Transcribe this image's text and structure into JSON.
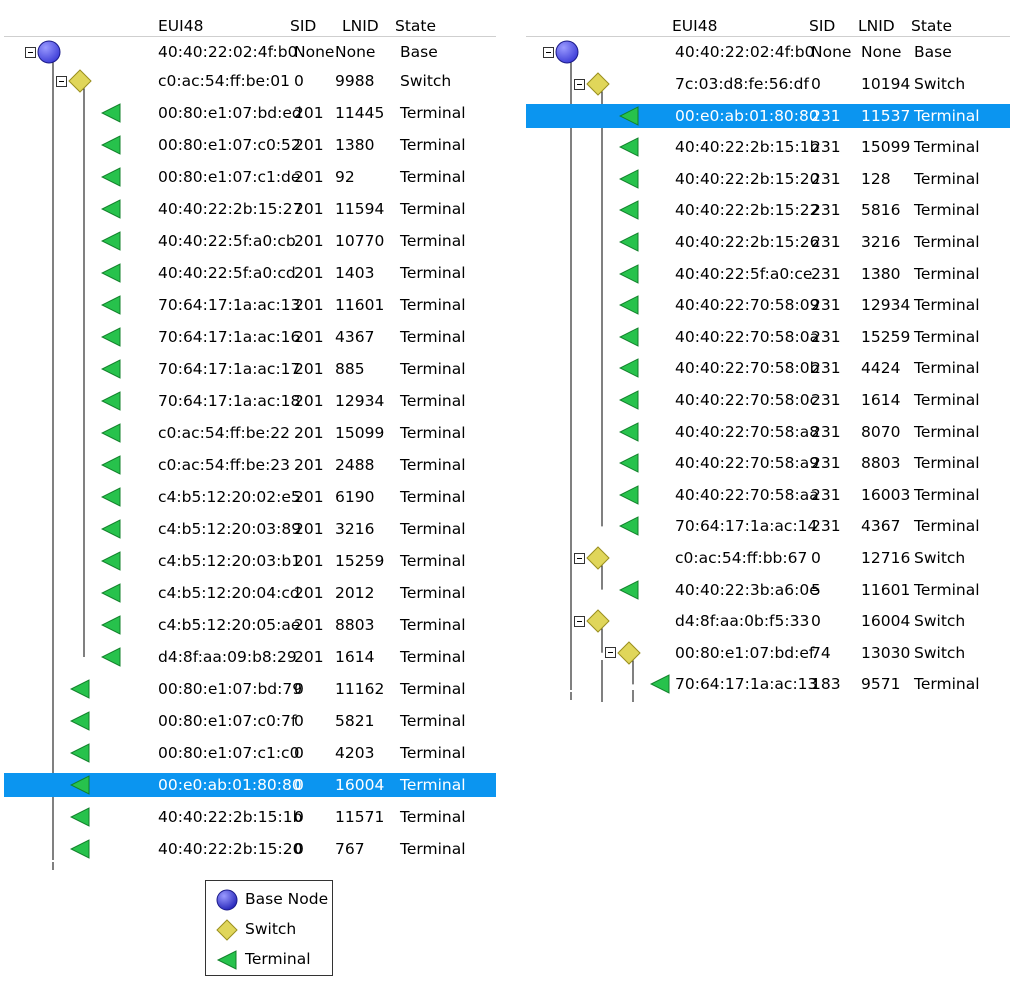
{
  "columns": [
    "EUI48",
    "SID",
    "LNID",
    "State"
  ],
  "colors": {
    "selection": "#0b95f0",
    "base_node": "#3b3bd6",
    "switch": "#e0d65a",
    "terminal": "#27c24c"
  },
  "left_panel": {
    "rows": [
      {
        "eui48": "40:40:22:02:4f:b0",
        "sid": "None",
        "lnid": "None",
        "state": "Base",
        "type": "base",
        "level": 0,
        "expander": true
      },
      {
        "eui48": "c0:ac:54:ff:be:01",
        "sid": "0",
        "lnid": "9988",
        "state": "Switch",
        "type": "switch",
        "level": 1,
        "expander": true
      },
      {
        "eui48": "00:80:e1:07:bd:ed",
        "sid": "201",
        "lnid": "11445",
        "state": "Terminal",
        "type": "terminal",
        "level": 2
      },
      {
        "eui48": "00:80:e1:07:c0:52",
        "sid": "201",
        "lnid": "1380",
        "state": "Terminal",
        "type": "terminal",
        "level": 2
      },
      {
        "eui48": "00:80:e1:07:c1:de",
        "sid": "201",
        "lnid": "92",
        "state": "Terminal",
        "type": "terminal",
        "level": 2
      },
      {
        "eui48": "40:40:22:2b:15:27",
        "sid": "201",
        "lnid": "11594",
        "state": "Terminal",
        "type": "terminal",
        "level": 2
      },
      {
        "eui48": "40:40:22:5f:a0:cb",
        "sid": "201",
        "lnid": "10770",
        "state": "Terminal",
        "type": "terminal",
        "level": 2
      },
      {
        "eui48": "40:40:22:5f:a0:cd",
        "sid": "201",
        "lnid": "1403",
        "state": "Terminal",
        "type": "terminal",
        "level": 2
      },
      {
        "eui48": "70:64:17:1a:ac:13",
        "sid": "201",
        "lnid": "11601",
        "state": "Terminal",
        "type": "terminal",
        "level": 2
      },
      {
        "eui48": "70:64:17:1a:ac:16",
        "sid": "201",
        "lnid": "4367",
        "state": "Terminal",
        "type": "terminal",
        "level": 2
      },
      {
        "eui48": "70:64:17:1a:ac:17",
        "sid": "201",
        "lnid": "885",
        "state": "Terminal",
        "type": "terminal",
        "level": 2
      },
      {
        "eui48": "70:64:17:1a:ac:18",
        "sid": "201",
        "lnid": "12934",
        "state": "Terminal",
        "type": "terminal",
        "level": 2
      },
      {
        "eui48": "c0:ac:54:ff:be:22",
        "sid": "201",
        "lnid": "15099",
        "state": "Terminal",
        "type": "terminal",
        "level": 2
      },
      {
        "eui48": "c0:ac:54:ff:be:23",
        "sid": "201",
        "lnid": "2488",
        "state": "Terminal",
        "type": "terminal",
        "level": 2
      },
      {
        "eui48": "c4:b5:12:20:02:e5",
        "sid": "201",
        "lnid": "6190",
        "state": "Terminal",
        "type": "terminal",
        "level": 2
      },
      {
        "eui48": "c4:b5:12:20:03:89",
        "sid": "201",
        "lnid": "3216",
        "state": "Terminal",
        "type": "terminal",
        "level": 2
      },
      {
        "eui48": "c4:b5:12:20:03:b1",
        "sid": "201",
        "lnid": "15259",
        "state": "Terminal",
        "type": "terminal",
        "level": 2
      },
      {
        "eui48": "c4:b5:12:20:04:cd",
        "sid": "201",
        "lnid": "2012",
        "state": "Terminal",
        "type": "terminal",
        "level": 2
      },
      {
        "eui48": "c4:b5:12:20:05:ae",
        "sid": "201",
        "lnid": "8803",
        "state": "Terminal",
        "type": "terminal",
        "level": 2
      },
      {
        "eui48": "d4:8f:aa:09:b8:29",
        "sid": "201",
        "lnid": "1614",
        "state": "Terminal",
        "type": "terminal",
        "level": 2
      },
      {
        "eui48": "00:80:e1:07:bd:79",
        "sid": "0",
        "lnid": "11162",
        "state": "Terminal",
        "type": "terminal",
        "level": 1
      },
      {
        "eui48": "00:80:e1:07:c0:7f",
        "sid": "0",
        "lnid": "5821",
        "state": "Terminal",
        "type": "terminal",
        "level": 1
      },
      {
        "eui48": "00:80:e1:07:c1:c0",
        "sid": "0",
        "lnid": "4203",
        "state": "Terminal",
        "type": "terminal",
        "level": 1
      },
      {
        "eui48": "00:e0:ab:01:80:80",
        "sid": "0",
        "lnid": "16004",
        "state": "Terminal",
        "type": "terminal",
        "level": 1,
        "selected": true
      },
      {
        "eui48": "40:40:22:2b:15:1b",
        "sid": "0",
        "lnid": "11571",
        "state": "Terminal",
        "type": "terminal",
        "level": 1
      },
      {
        "eui48": "40:40:22:2b:15:20",
        "sid": "0",
        "lnid": "767",
        "state": "Terminal",
        "type": "terminal",
        "level": 1
      }
    ]
  },
  "right_panel": {
    "rows": [
      {
        "eui48": "40:40:22:02:4f:b0",
        "sid": "None",
        "lnid": "None",
        "state": "Base",
        "type": "base",
        "level": 0,
        "expander": true
      },
      {
        "eui48": "7c:03:d8:fe:56:df",
        "sid": "0",
        "lnid": "10194",
        "state": "Switch",
        "type": "switch",
        "level": 1,
        "expander": true
      },
      {
        "eui48": "00:e0:ab:01:80:80",
        "sid": "231",
        "lnid": "11537",
        "state": "Terminal",
        "type": "terminal",
        "level": 2,
        "selected": true
      },
      {
        "eui48": "40:40:22:2b:15:1b",
        "sid": "231",
        "lnid": "15099",
        "state": "Terminal",
        "type": "terminal",
        "level": 2
      },
      {
        "eui48": "40:40:22:2b:15:20",
        "sid": "231",
        "lnid": "128",
        "state": "Terminal",
        "type": "terminal",
        "level": 2
      },
      {
        "eui48": "40:40:22:2b:15:22",
        "sid": "231",
        "lnid": "5816",
        "state": "Terminal",
        "type": "terminal",
        "level": 2
      },
      {
        "eui48": "40:40:22:2b:15:26",
        "sid": "231",
        "lnid": "3216",
        "state": "Terminal",
        "type": "terminal",
        "level": 2
      },
      {
        "eui48": "40:40:22:5f:a0:ce",
        "sid": "231",
        "lnid": "1380",
        "state": "Terminal",
        "type": "terminal",
        "level": 2
      },
      {
        "eui48": "40:40:22:70:58:09",
        "sid": "231",
        "lnid": "12934",
        "state": "Terminal",
        "type": "terminal",
        "level": 2
      },
      {
        "eui48": "40:40:22:70:58:0a",
        "sid": "231",
        "lnid": "15259",
        "state": "Terminal",
        "type": "terminal",
        "level": 2
      },
      {
        "eui48": "40:40:22:70:58:0b",
        "sid": "231",
        "lnid": "4424",
        "state": "Terminal",
        "type": "terminal",
        "level": 2
      },
      {
        "eui48": "40:40:22:70:58:0c",
        "sid": "231",
        "lnid": "1614",
        "state": "Terminal",
        "type": "terminal",
        "level": 2
      },
      {
        "eui48": "40:40:22:70:58:a8",
        "sid": "231",
        "lnid": "8070",
        "state": "Terminal",
        "type": "terminal",
        "level": 2
      },
      {
        "eui48": "40:40:22:70:58:a9",
        "sid": "231",
        "lnid": "8803",
        "state": "Terminal",
        "type": "terminal",
        "level": 2
      },
      {
        "eui48": "40:40:22:70:58:aa",
        "sid": "231",
        "lnid": "16003",
        "state": "Terminal",
        "type": "terminal",
        "level": 2
      },
      {
        "eui48": "70:64:17:1a:ac:14",
        "sid": "231",
        "lnid": "4367",
        "state": "Terminal",
        "type": "terminal",
        "level": 2
      },
      {
        "eui48": "c0:ac:54:ff:bb:67",
        "sid": "0",
        "lnid": "12716",
        "state": "Switch",
        "type": "switch",
        "level": 1,
        "expander": true
      },
      {
        "eui48": "40:40:22:3b:a6:0e",
        "sid": "5",
        "lnid": "11601",
        "state": "Terminal",
        "type": "terminal",
        "level": 2
      },
      {
        "eui48": "d4:8f:aa:0b:f5:33",
        "sid": "0",
        "lnid": "16004",
        "state": "Switch",
        "type": "switch",
        "level": 1,
        "expander": true
      },
      {
        "eui48": "00:80:e1:07:bd:ef",
        "sid": "74",
        "lnid": "13030",
        "state": "Switch",
        "type": "switch",
        "level": 2,
        "expander": true
      },
      {
        "eui48": "70:64:17:1a:ac:13",
        "sid": "183",
        "lnid": "9571",
        "state": "Terminal",
        "type": "terminal",
        "level": 3
      }
    ]
  },
  "legend": {
    "items": [
      {
        "label": "Base Node",
        "type": "base"
      },
      {
        "label": "Switch",
        "type": "switch"
      },
      {
        "label": "Terminal",
        "type": "terminal"
      }
    ]
  }
}
